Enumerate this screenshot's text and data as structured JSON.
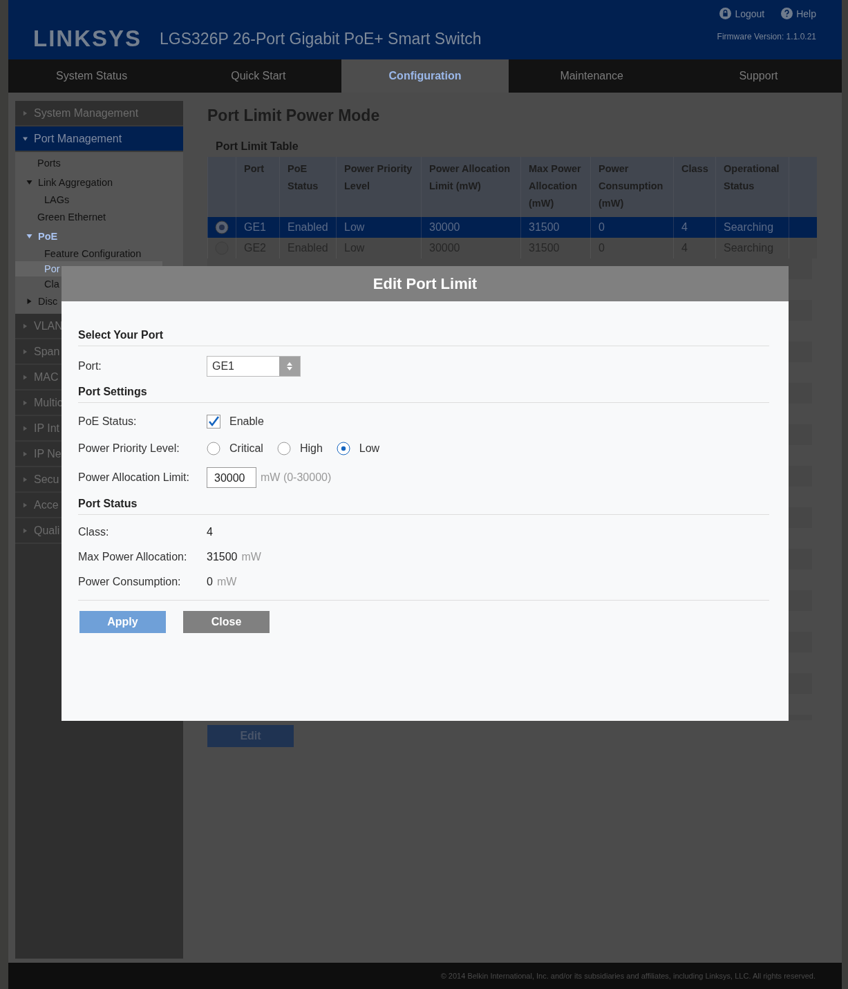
{
  "header": {
    "logo": "LINKSYS",
    "product": "LGS326P 26-Port Gigabit PoE+ Smart Switch",
    "links": [
      {
        "kind": "logout",
        "label": "Logout"
      },
      {
        "kind": "help",
        "label": "Help"
      }
    ],
    "firmware": "Firmware Version: 1.1.0.21"
  },
  "tabs": [
    {
      "label": "System Status",
      "selected": false
    },
    {
      "label": "Quick Start",
      "selected": false
    },
    {
      "label": "Configuration",
      "selected": true
    },
    {
      "label": "Maintenance",
      "selected": false
    },
    {
      "label": "Support",
      "selected": false
    }
  ],
  "sidebar": {
    "items": [
      {
        "label": "System Management",
        "expanded": false,
        "selected": false
      },
      {
        "label": "Port Management",
        "expanded": true,
        "selected": true,
        "children": [
          {
            "label": "Ports",
            "selected": false
          },
          {
            "label": "Link Aggregation",
            "expanded": true,
            "selected": false,
            "children": [
              {
                "label": "LAGs",
                "selected": false
              }
            ]
          },
          {
            "label": "Green Ethernet",
            "selected": false
          },
          {
            "label": "PoE",
            "expanded": true,
            "selected": true,
            "children": [
              {
                "label": "Feature Configuration",
                "selected": false
              },
              {
                "label": "Por",
                "selected": true
              },
              {
                "label": "Cla",
                "selected": false
              }
            ]
          },
          {
            "label": "Disc",
            "expanded": false,
            "selected": false
          }
        ]
      },
      {
        "label": "VLAN",
        "expanded": false,
        "selected": false
      },
      {
        "label": "Span",
        "expanded": false,
        "selected": false
      },
      {
        "label": "MAC",
        "expanded": false,
        "selected": false
      },
      {
        "label": "Multic",
        "expanded": false,
        "selected": false
      },
      {
        "label": "IP Int",
        "expanded": false,
        "selected": false
      },
      {
        "label": "IP Ne",
        "expanded": false,
        "selected": false
      },
      {
        "label": "Secu",
        "expanded": false,
        "selected": false
      },
      {
        "label": "Acce",
        "expanded": false,
        "selected": false
      },
      {
        "label": "Quali",
        "expanded": false,
        "selected": false
      }
    ]
  },
  "page": {
    "title": "Port Limit Power Mode",
    "table": {
      "title": "Port Limit Table",
      "columns": [
        "Port",
        "PoE Status",
        "Power Priority Level",
        "Power Allocation Limit (mW)",
        "Max Power Allocation (mW)",
        "Power Consumption (mW)",
        "Class",
        "Operational Status"
      ],
      "rows": [
        {
          "selected": true,
          "cells": [
            "GE1",
            "Enabled",
            "Low",
            "30000",
            "31500",
            "0",
            "4",
            "Searching"
          ]
        },
        {
          "selected": false,
          "cells": [
            "GE2",
            "Enabled",
            "Low",
            "30000",
            "31500",
            "0",
            "4",
            "Searching"
          ]
        }
      ]
    },
    "edit_button": "Edit"
  },
  "modal": {
    "title": "Edit Port Limit",
    "sections": [
      {
        "heading": "Select Your Port",
        "fields": [
          {
            "kind": "select",
            "label": "Port:",
            "value": "GE1"
          }
        ]
      },
      {
        "heading": "Port Settings",
        "fields": [
          {
            "kind": "checkbox",
            "label": "PoE Status:",
            "option": "Enable",
            "checked": true
          },
          {
            "kind": "radio",
            "label": "Power Priority Level:",
            "options": [
              {
                "label": "Critical",
                "selected": false
              },
              {
                "label": "High",
                "selected": false
              },
              {
                "label": "Low",
                "selected": true
              }
            ]
          },
          {
            "kind": "input",
            "label": "Power Allocation Limit:",
            "value": "30000",
            "hint": "mW (0-30000)"
          }
        ]
      },
      {
        "heading": "Port Status",
        "fields": [
          {
            "kind": "text",
            "label": "Class:",
            "value": "4"
          },
          {
            "kind": "text",
            "label": "Max Power Allocation:",
            "value": "31500",
            "unit": "mW"
          },
          {
            "kind": "text",
            "label": "Power Consumption:",
            "value": "0",
            "unit": "mW"
          }
        ]
      }
    ],
    "buttons": [
      {
        "kind": "primary",
        "label": "Apply"
      },
      {
        "kind": "secondary",
        "label": "Close"
      }
    ]
  },
  "footer": "© 2014 Belkin International, Inc. and/or its subsidiaries and affiliates, including Linksys, LLC. All rights reserved."
}
